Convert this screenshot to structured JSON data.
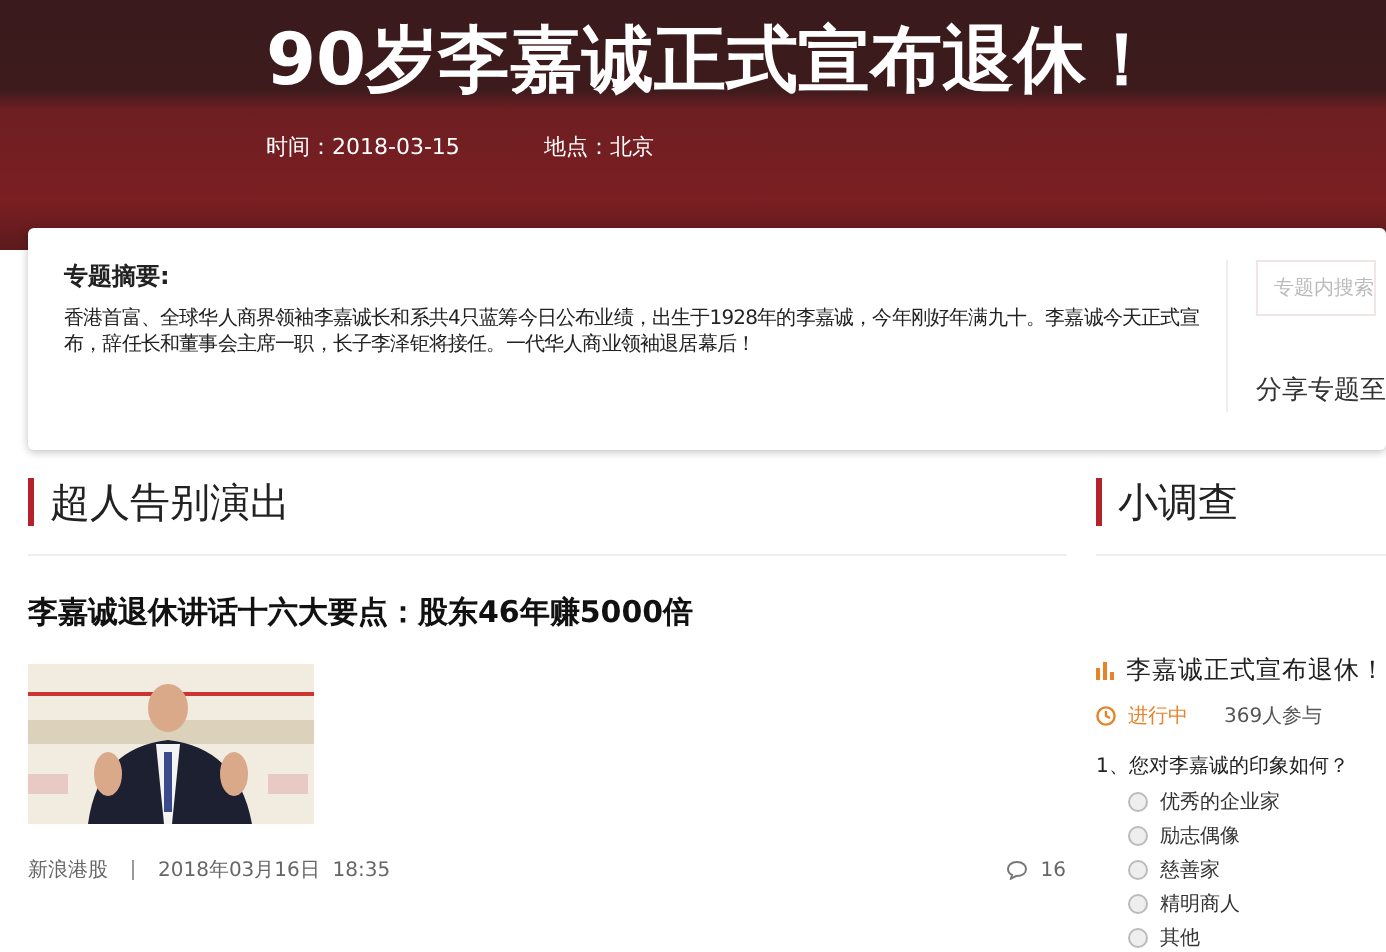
{
  "header": {
    "title": "90岁李嘉诚正式宣布退休！",
    "time": "时间：2018-03-15",
    "place": "地点：北京"
  },
  "summary": {
    "heading": "专题摘要:",
    "text": "香港首富、全球华人商界领袖李嘉诚长和系共4只蓝筹今日公布业绩，出生于1928年的李嘉诚，今年刚好年满九十。李嘉诚今天正式宣布，辞任长和董事会主席一职，长子李泽钜将接任。一代华人商业领袖退居幕后！",
    "search_placeholder": "专题内搜索",
    "share": "分享专题至"
  },
  "section": {
    "title": "超人告别演出",
    "article": {
      "title": "李嘉诚退休讲话十六大要点：股东46年赚5000倍",
      "source": "新浪港股",
      "date": "2018年03月16日  18:35",
      "comments": "16"
    }
  },
  "survey": {
    "title": "小调查",
    "poll_title": "李嘉诚正式宣布退休！",
    "status": "进行中",
    "participants": "369人参与",
    "question": "1、您对李嘉诚的印象如何？",
    "options": [
      {
        "label": "优秀的企业家",
        "selected": false
      },
      {
        "label": "励志偶像",
        "selected": false
      },
      {
        "label": "慈善家",
        "selected": false
      },
      {
        "label": "精明商人",
        "selected": false
      },
      {
        "label": "其他",
        "selected": false
      }
    ]
  }
}
